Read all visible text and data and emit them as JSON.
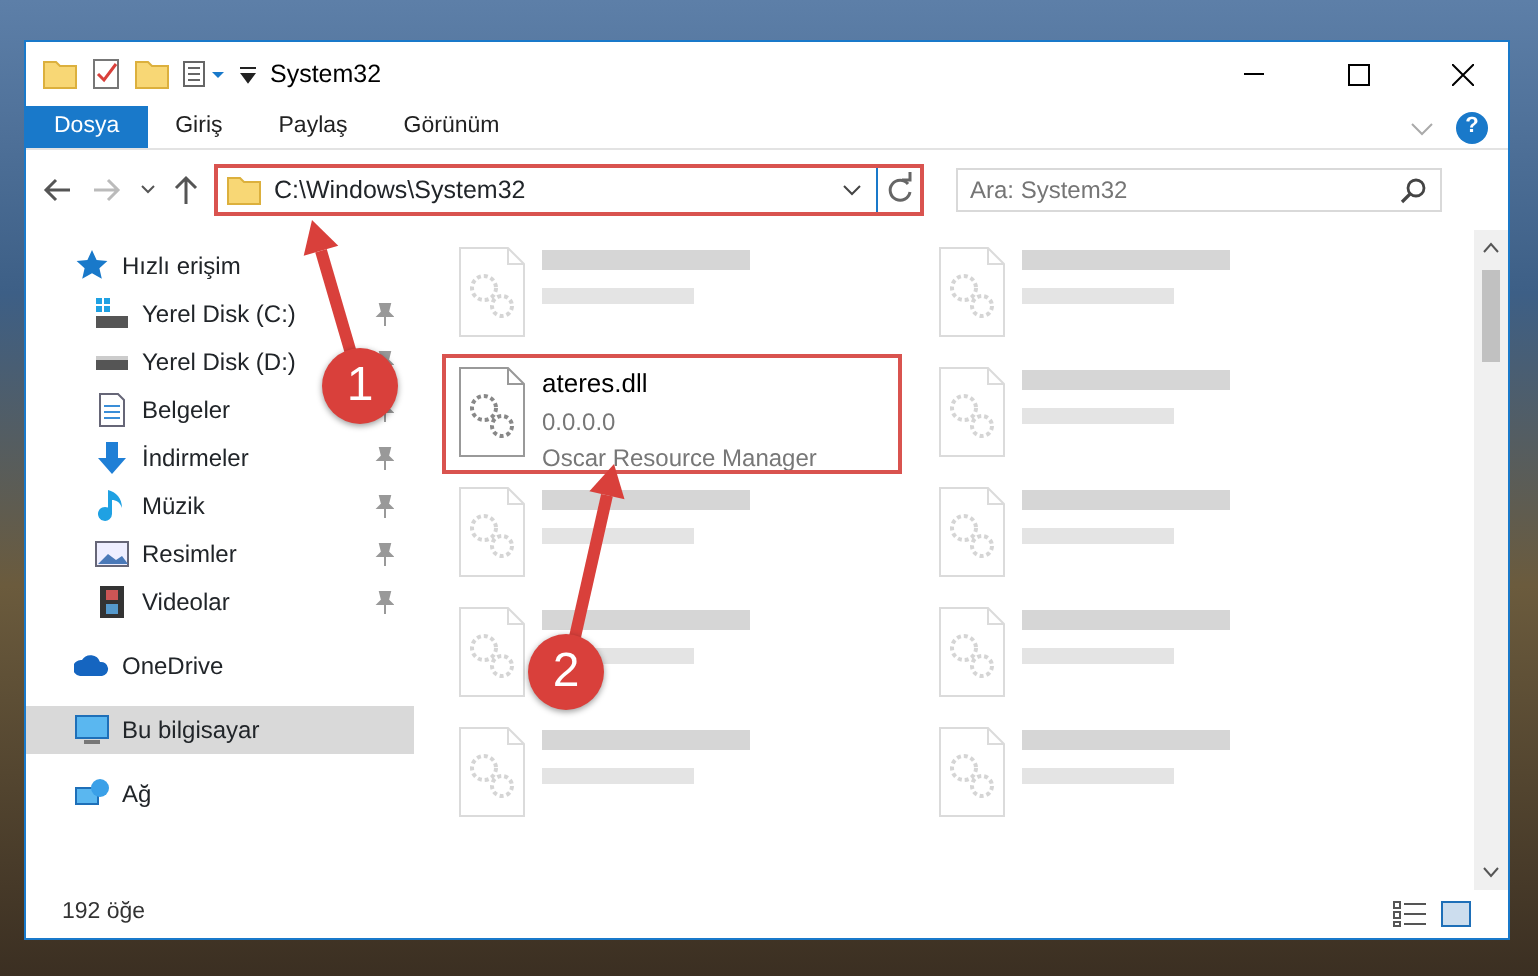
{
  "window": {
    "title": "System32"
  },
  "ribbon": {
    "tabs": [
      {
        "label": "Dosya",
        "selected": true
      },
      {
        "label": "Giriş",
        "selected": false
      },
      {
        "label": "Paylaş",
        "selected": false
      },
      {
        "label": "Görünüm",
        "selected": false
      }
    ],
    "help": "?"
  },
  "address_bar": {
    "path": "C:\\Windows\\System32",
    "highlighted": true
  },
  "search": {
    "placeholder": "Ara: System32"
  },
  "sidebar": {
    "items": [
      {
        "label": "Hızlı erişim",
        "kind": "star",
        "selected": false,
        "children": [
          {
            "label": "Yerel Disk (C:)",
            "kind": "sysdrive",
            "pinned": true,
            "selected": false
          },
          {
            "label": "Yerel Disk (D:)",
            "kind": "drive",
            "pinned": true,
            "selected": false
          },
          {
            "label": "Belgeler",
            "kind": "docs",
            "pinned": true,
            "selected": false
          },
          {
            "label": "İndirmeler",
            "kind": "download",
            "pinned": true,
            "selected": false
          },
          {
            "label": "Müzik",
            "kind": "music",
            "pinned": true,
            "selected": false
          },
          {
            "label": "Resimler",
            "kind": "pictures",
            "pinned": true,
            "selected": false
          },
          {
            "label": "Videolar",
            "kind": "video",
            "pinned": true,
            "selected": false
          }
        ]
      },
      {
        "label": "OneDrive",
        "kind": "cloud",
        "selected": false
      },
      {
        "label": "Bu bilgisayar",
        "kind": "computer",
        "selected": true
      },
      {
        "label": "Ağ",
        "kind": "network",
        "selected": false
      }
    ]
  },
  "files": [
    {
      "blurred": true,
      "highlighted": false
    },
    {
      "blurred": true,
      "highlighted": false
    },
    {
      "name": "ateres.dll",
      "lines": [
        "0.0.0.0",
        "Oscar Resource Manager"
      ],
      "blurred": false,
      "highlighted": true
    },
    {
      "blurred": true,
      "highlighted": false
    },
    {
      "blurred": true,
      "highlighted": false
    },
    {
      "blurred": true,
      "highlighted": false
    },
    {
      "blurred": true,
      "highlighted": false
    },
    {
      "blurred": true,
      "highlighted": false
    },
    {
      "blurred": true,
      "highlighted": false
    },
    {
      "blurred": true,
      "highlighted": false
    }
  ],
  "status_bar": {
    "count": "192 öğe"
  },
  "annotations": [
    {
      "label": "1"
    },
    {
      "label": "2"
    }
  ]
}
